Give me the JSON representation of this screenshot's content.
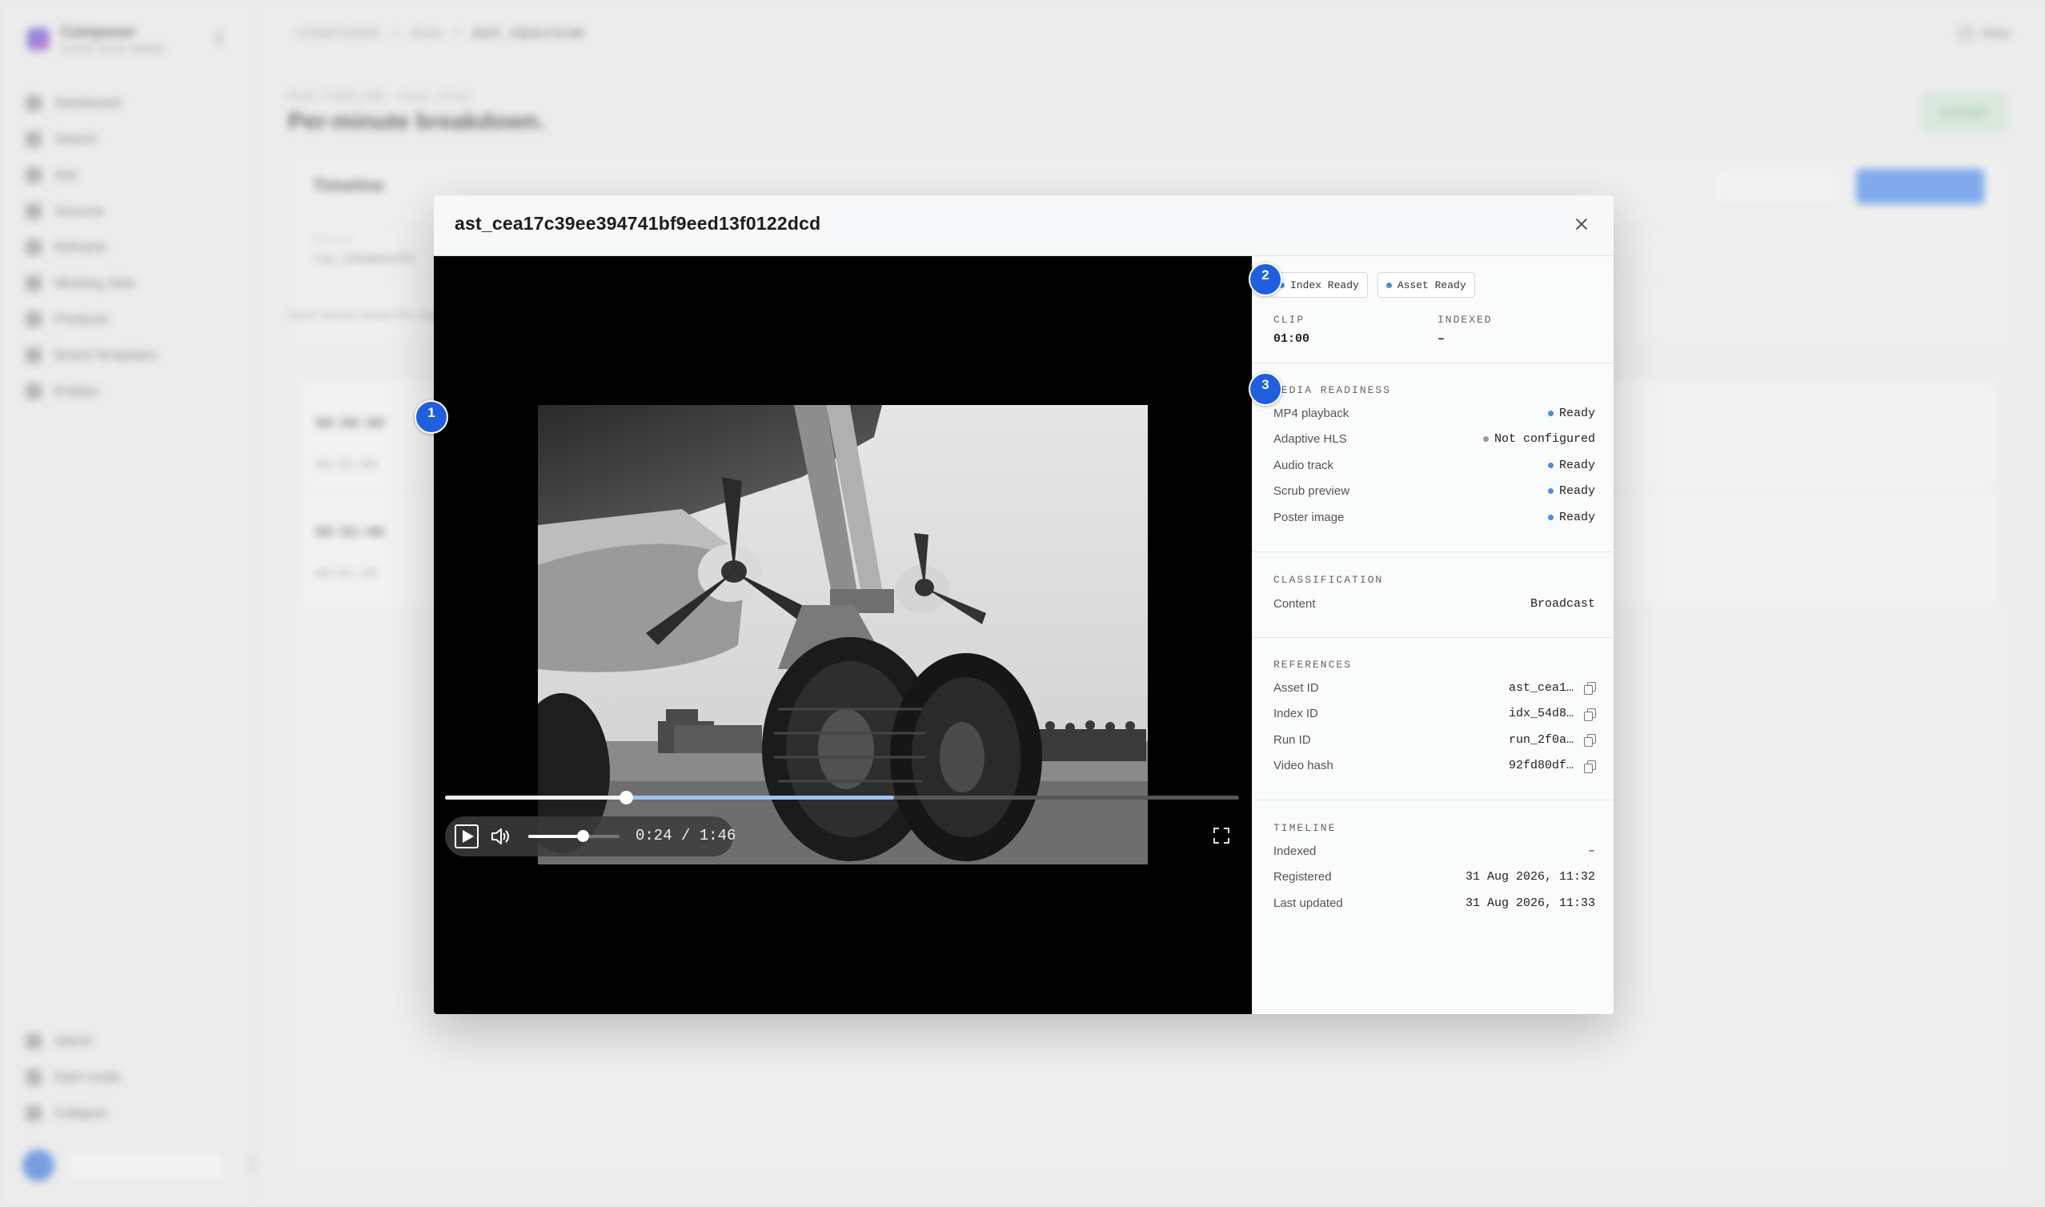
{
  "background": {
    "brand": {
      "name": "Composer",
      "subtitle": "AUDIO SEGS MEMO"
    },
    "nav_items": [
      "Dashboard",
      "Search",
      "Ask",
      "Sources",
      "Reframe",
      "Working Sets",
      "Producer",
      "Brand Templates",
      "Entities"
    ],
    "nav_bottom": [
      "Admin",
      "Dark mode",
      "Collapse"
    ],
    "breadcrumbs": [
      "COMPOSER",
      "RUN",
      "AST_CEA17C39"
    ],
    "view_label": "View",
    "eyebrow": "RUN TIMELINE · RUN_2F0A",
    "page_title": "Per-minute breakdown.",
    "export_label": "EXPORT",
    "card_title": "Timeline",
    "meta_run_id_label": "RUN ID",
    "meta_run_id_value": "run_2f0a8d12f0",
    "description": "Each minute shows the segments detected",
    "rows": [
      {
        "start": "00:00:00",
        "end": "00:01:00"
      },
      {
        "start": "00:01:00",
        "end": "00:01:46"
      }
    ]
  },
  "modal": {
    "title": "ast_cea17c39ee394741bf9eed13f0122dcd",
    "close_icon": "close-icon",
    "player": {
      "time_label": "0:24 / 1:46",
      "played_fraction": 0.228,
      "buffered_fraction": 0.566,
      "volume_fraction": 0.6,
      "play_icon": "play-icon",
      "volume_icon": "volume-icon",
      "fullscreen_icon": "fullscreen-icon"
    },
    "panel": {
      "badges": [
        "Index Ready",
        "Asset Ready"
      ],
      "clip_label": "CLIP",
      "clip_value": "01:00",
      "indexed_label": "INDEXED",
      "indexed_value": "–",
      "media_readiness": {
        "title": "MEDIA READINESS",
        "rows": [
          {
            "label": "MP4 playback",
            "value": "Ready",
            "status": "ready"
          },
          {
            "label": "Adaptive HLS",
            "value": "Not configured",
            "status": "off"
          },
          {
            "label": "Audio track",
            "value": "Ready",
            "status": "ready"
          },
          {
            "label": "Scrub preview",
            "value": "Ready",
            "status": "ready"
          },
          {
            "label": "Poster image",
            "value": "Ready",
            "status": "ready"
          }
        ]
      },
      "classification": {
        "title": "CLASSIFICATION",
        "rows": [
          {
            "label": "Content",
            "value": "Broadcast"
          }
        ]
      },
      "references": {
        "title": "REFERENCES",
        "rows": [
          {
            "label": "Asset ID",
            "value": "ast_cea1…"
          },
          {
            "label": "Index ID",
            "value": "idx_54d8…"
          },
          {
            "label": "Run ID",
            "value": "run_2f0a…"
          },
          {
            "label": "Video hash",
            "value": "92fd80df…"
          }
        ]
      },
      "timeline": {
        "title": "TIMELINE",
        "rows": [
          {
            "label": "Indexed",
            "value": "–"
          },
          {
            "label": "Registered",
            "value": "31 Aug 2026, 11:32"
          },
          {
            "label": "Last updated",
            "value": "31 Aug 2026, 11:33"
          }
        ]
      }
    }
  },
  "markers": [
    "1",
    "2",
    "3"
  ],
  "colors": {
    "accent": "#1f5fde",
    "ready_dot": "#4a8fd6",
    "off_dot": "#9a9a9a"
  }
}
